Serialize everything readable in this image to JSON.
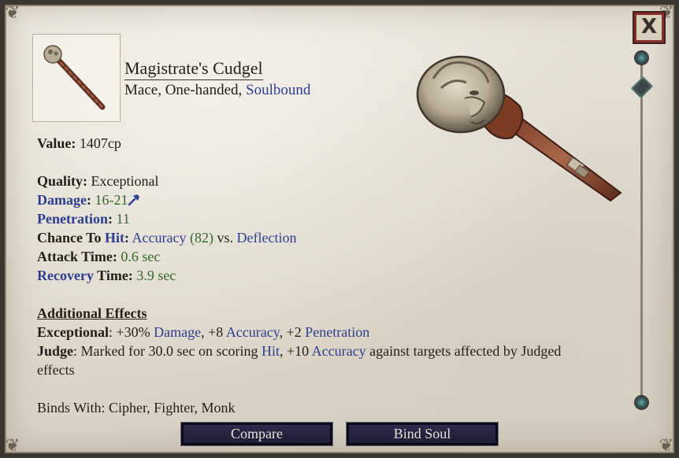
{
  "window": {
    "close_label": "X"
  },
  "item": {
    "name": "Magistrate's Cudgel",
    "type_prefix": "Mace, One-handed, ",
    "type_link": "Soulbound"
  },
  "stats": {
    "value_label": "Value:",
    "value": "1407cp",
    "quality_label": "Quality:",
    "quality": "Exceptional",
    "damage_label": "Damage",
    "damage": "16-21",
    "penetration_label": "Penetration",
    "penetration": "11",
    "chance_label_a": "Chance To ",
    "chance_label_hit": "Hit",
    "chance_accuracy": "Accuracy",
    "chance_accuracy_value": "(82)",
    "chance_vs": " vs. ",
    "chance_deflection": "Deflection",
    "attack_time_label": "Attack Time:",
    "attack_time": "0.6 sec",
    "recovery_label": "Recovery",
    "recovery_time_label": " Time:",
    "recovery_time": "3.9 sec"
  },
  "effects": {
    "header": "Additional Effects",
    "exceptional_label": "Exceptional",
    "exceptional_a": ": +30% ",
    "exceptional_damage": "Damage",
    "exceptional_b": ", +8 ",
    "exceptional_accuracy": "Accuracy",
    "exceptional_c": ", +2 ",
    "exceptional_penetration": "Penetration",
    "judge_label": "Judge",
    "judge_a": ": Marked for 30.0 sec on scoring ",
    "judge_hit": "Hit",
    "judge_b": ", +10 ",
    "judge_accuracy": "Accuracy",
    "judge_c": " against targets affected by Judged",
    "judge_d": "effects"
  },
  "binds_with": "Binds With: Cipher, Fighter, Monk",
  "buttons": {
    "compare": "Compare",
    "bind_soul": "Bind Soul"
  },
  "icons": {
    "damage_type": "crush-hammer-icon",
    "close": "close-x-icon"
  },
  "colors": {
    "link_blue": "#2e3d8f",
    "value_green": "#35652f",
    "parchment": "#e3ddd2",
    "button_bg": "#25233f"
  }
}
